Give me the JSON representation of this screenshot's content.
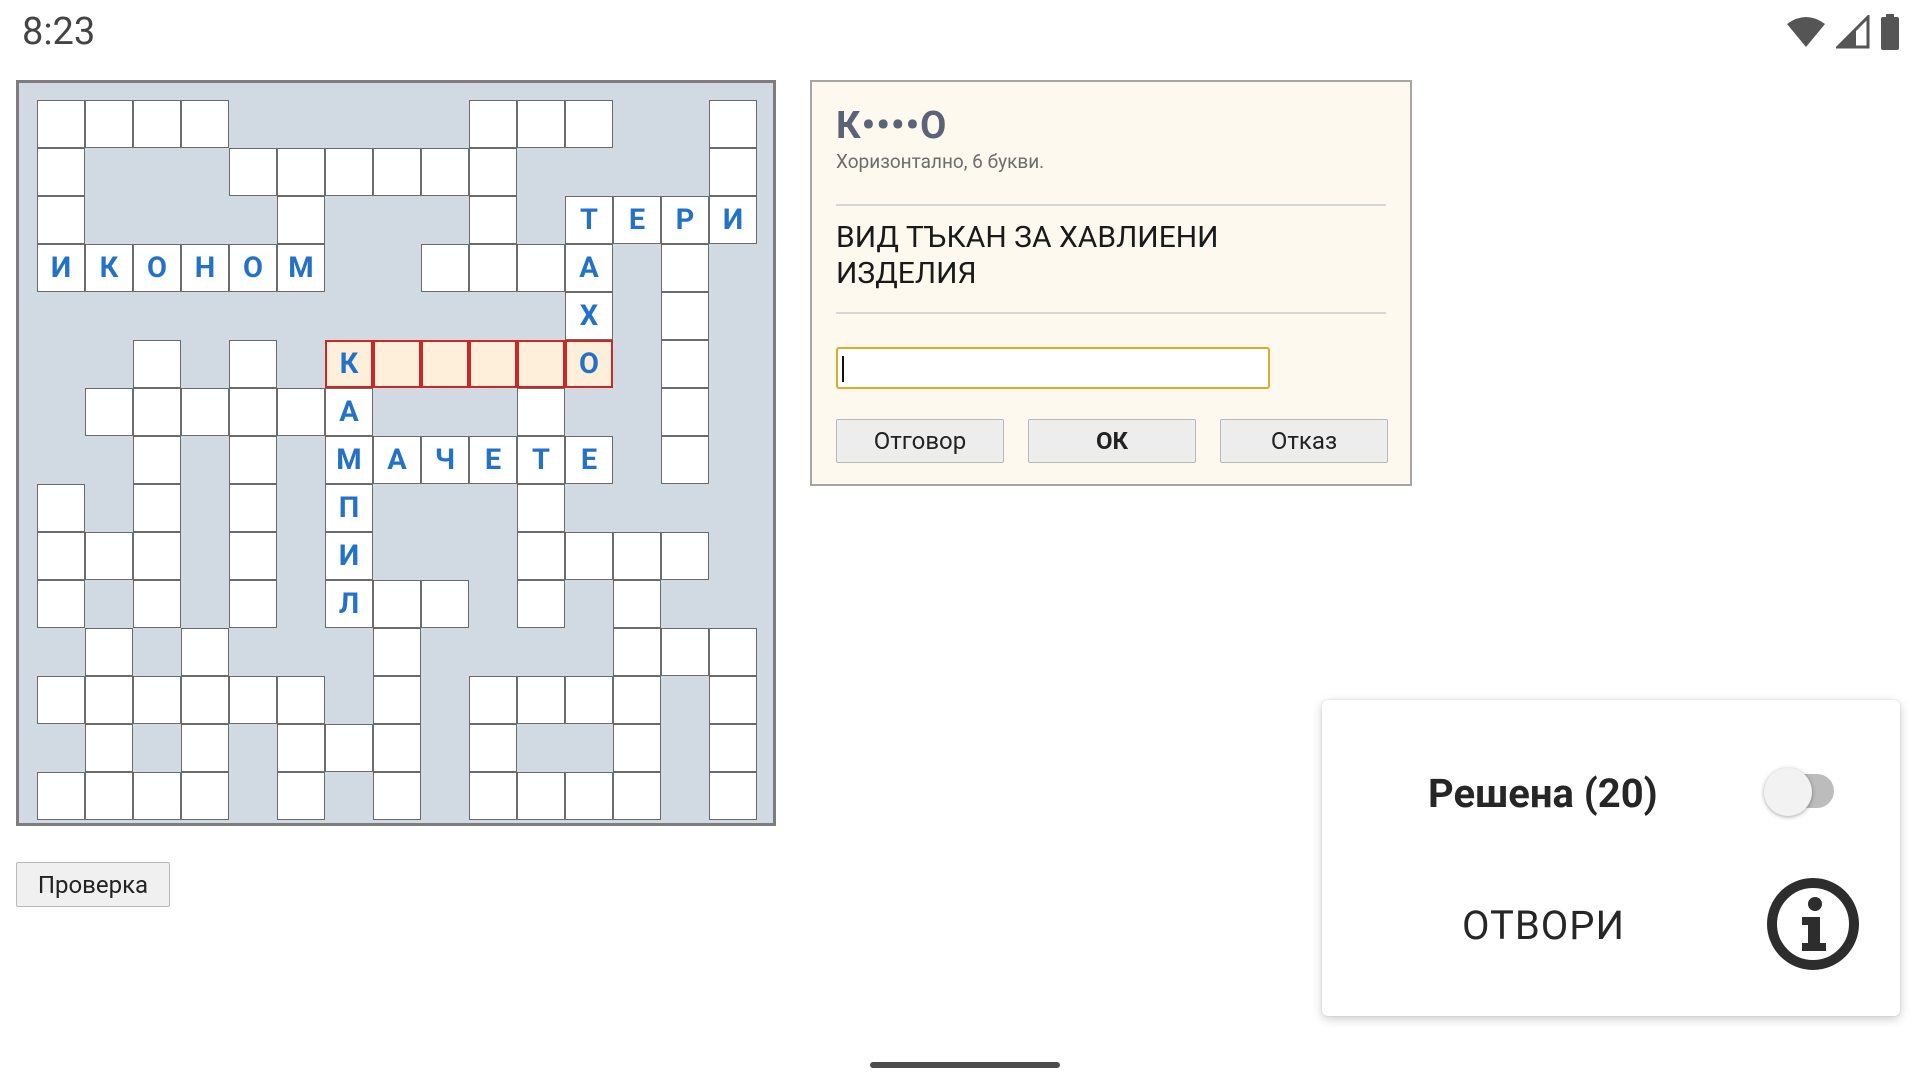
{
  "status_bar": {
    "time": "8:23",
    "icons": [
      "wifi-icon",
      "signal-icon",
      "battery-icon"
    ]
  },
  "crossword": {
    "accent_color": "#2372c8",
    "selected_color": "#fdefd9",
    "selected_border_color": "#c92828",
    "cells": [
      {
        "r": 0,
        "c": 0
      },
      {
        "r": 0,
        "c": 1
      },
      {
        "r": 0,
        "c": 2
      },
      {
        "r": 0,
        "c": 3
      },
      {
        "r": 0,
        "c": 9
      },
      {
        "r": 0,
        "c": 10
      },
      {
        "r": 0,
        "c": 11
      },
      {
        "r": 0,
        "c": 14
      },
      {
        "r": 1,
        "c": 0
      },
      {
        "r": 1,
        "c": 4
      },
      {
        "r": 1,
        "c": 5
      },
      {
        "r": 1,
        "c": 6
      },
      {
        "r": 1,
        "c": 7
      },
      {
        "r": 1,
        "c": 8
      },
      {
        "r": 1,
        "c": 9
      },
      {
        "r": 1,
        "c": 14
      },
      {
        "r": 2,
        "c": 0
      },
      {
        "r": 2,
        "c": 5
      },
      {
        "r": 2,
        "c": 9
      },
      {
        "r": 2,
        "c": 11,
        "ch": "Т"
      },
      {
        "r": 2,
        "c": 12,
        "ch": "Е"
      },
      {
        "r": 2,
        "c": 13,
        "ch": "Р"
      },
      {
        "r": 2,
        "c": 14,
        "ch": "И"
      },
      {
        "r": 3,
        "c": 0,
        "ch": "И"
      },
      {
        "r": 3,
        "c": 1,
        "ch": "К"
      },
      {
        "r": 3,
        "c": 2,
        "ch": "О"
      },
      {
        "r": 3,
        "c": 3,
        "ch": "Н"
      },
      {
        "r": 3,
        "c": 4,
        "ch": "О"
      },
      {
        "r": 3,
        "c": 5,
        "ch": "М"
      },
      {
        "r": 3,
        "c": 8
      },
      {
        "r": 3,
        "c": 9
      },
      {
        "r": 3,
        "c": 10
      },
      {
        "r": 3,
        "c": 11,
        "ch": "А"
      },
      {
        "r": 3,
        "c": 13
      },
      {
        "r": 4,
        "c": 11,
        "ch": "Х"
      },
      {
        "r": 4,
        "c": 13
      },
      {
        "r": 5,
        "c": 2
      },
      {
        "r": 5,
        "c": 4
      },
      {
        "r": 5,
        "c": 6,
        "ch": "К",
        "sel": true
      },
      {
        "r": 5,
        "c": 7,
        "sel": true
      },
      {
        "r": 5,
        "c": 8,
        "sel": true
      },
      {
        "r": 5,
        "c": 9,
        "sel": true
      },
      {
        "r": 5,
        "c": 10,
        "sel": true
      },
      {
        "r": 5,
        "c": 11,
        "ch": "О",
        "sel": true
      },
      {
        "r": 5,
        "c": 13
      },
      {
        "r": 6,
        "c": 1
      },
      {
        "r": 6,
        "c": 2
      },
      {
        "r": 6,
        "c": 3
      },
      {
        "r": 6,
        "c": 4
      },
      {
        "r": 6,
        "c": 5
      },
      {
        "r": 6,
        "c": 6,
        "ch": "А"
      },
      {
        "r": 6,
        "c": 10
      },
      {
        "r": 6,
        "c": 13
      },
      {
        "r": 7,
        "c": 2
      },
      {
        "r": 7,
        "c": 4
      },
      {
        "r": 7,
        "c": 6,
        "ch": "М"
      },
      {
        "r": 7,
        "c": 7,
        "ch": "А"
      },
      {
        "r": 7,
        "c": 8,
        "ch": "Ч"
      },
      {
        "r": 7,
        "c": 9,
        "ch": "Е"
      },
      {
        "r": 7,
        "c": 10,
        "ch": "Т"
      },
      {
        "r": 7,
        "c": 11,
        "ch": "Е"
      },
      {
        "r": 7,
        "c": 13
      },
      {
        "r": 8,
        "c": 0
      },
      {
        "r": 8,
        "c": 2
      },
      {
        "r": 8,
        "c": 4
      },
      {
        "r": 8,
        "c": 6,
        "ch": "П"
      },
      {
        "r": 8,
        "c": 10
      },
      {
        "r": 9,
        "c": 0
      },
      {
        "r": 9,
        "c": 1
      },
      {
        "r": 9,
        "c": 2
      },
      {
        "r": 9,
        "c": 4
      },
      {
        "r": 9,
        "c": 6,
        "ch": "И"
      },
      {
        "r": 9,
        "c": 10
      },
      {
        "r": 9,
        "c": 11
      },
      {
        "r": 9,
        "c": 12
      },
      {
        "r": 9,
        "c": 13
      },
      {
        "r": 10,
        "c": 0
      },
      {
        "r": 10,
        "c": 2
      },
      {
        "r": 10,
        "c": 4
      },
      {
        "r": 10,
        "c": 6,
        "ch": "Л"
      },
      {
        "r": 10,
        "c": 7
      },
      {
        "r": 10,
        "c": 8
      },
      {
        "r": 10,
        "c": 10
      },
      {
        "r": 10,
        "c": 12
      },
      {
        "r": 11,
        "c": 1
      },
      {
        "r": 11,
        "c": 3
      },
      {
        "r": 11,
        "c": 7
      },
      {
        "r": 11,
        "c": 12
      },
      {
        "r": 11,
        "c": 13
      },
      {
        "r": 11,
        "c": 14
      },
      {
        "r": 12,
        "c": 0
      },
      {
        "r": 12,
        "c": 1
      },
      {
        "r": 12,
        "c": 2
      },
      {
        "r": 12,
        "c": 3
      },
      {
        "r": 12,
        "c": 4
      },
      {
        "r": 12,
        "c": 5
      },
      {
        "r": 12,
        "c": 7
      },
      {
        "r": 12,
        "c": 9
      },
      {
        "r": 12,
        "c": 10
      },
      {
        "r": 12,
        "c": 11
      },
      {
        "r": 12,
        "c": 12
      },
      {
        "r": 12,
        "c": 14
      },
      {
        "r": 13,
        "c": 1
      },
      {
        "r": 13,
        "c": 3
      },
      {
        "r": 13,
        "c": 5
      },
      {
        "r": 13,
        "c": 6
      },
      {
        "r": 13,
        "c": 7
      },
      {
        "r": 13,
        "c": 9
      },
      {
        "r": 13,
        "c": 12
      },
      {
        "r": 13,
        "c": 14
      },
      {
        "r": 14,
        "c": 0
      },
      {
        "r": 14,
        "c": 1
      },
      {
        "r": 14,
        "c": 2
      },
      {
        "r": 14,
        "c": 3
      },
      {
        "r": 14,
        "c": 5
      },
      {
        "r": 14,
        "c": 7
      },
      {
        "r": 14,
        "c": 9
      },
      {
        "r": 14,
        "c": 10
      },
      {
        "r": 14,
        "c": 11
      },
      {
        "r": 14,
        "c": 12
      },
      {
        "r": 14,
        "c": 14
      }
    ]
  },
  "check_button_label": "Проверка",
  "dialog": {
    "word_pattern": "К••••О",
    "word_info": "Хоризонтално, 6 букви.",
    "clue": "ВИД ТЪКАН ЗА ХАВЛИЕНИ ИЗДЕЛИЯ",
    "answer_value": "",
    "buttons": {
      "answer": "Отговор",
      "ok": "ОК",
      "cancel": "Отказ"
    }
  },
  "panel": {
    "solved_label": "Решена (20)",
    "solved_toggle_on": false,
    "open_label": "ОТВОРИ"
  }
}
